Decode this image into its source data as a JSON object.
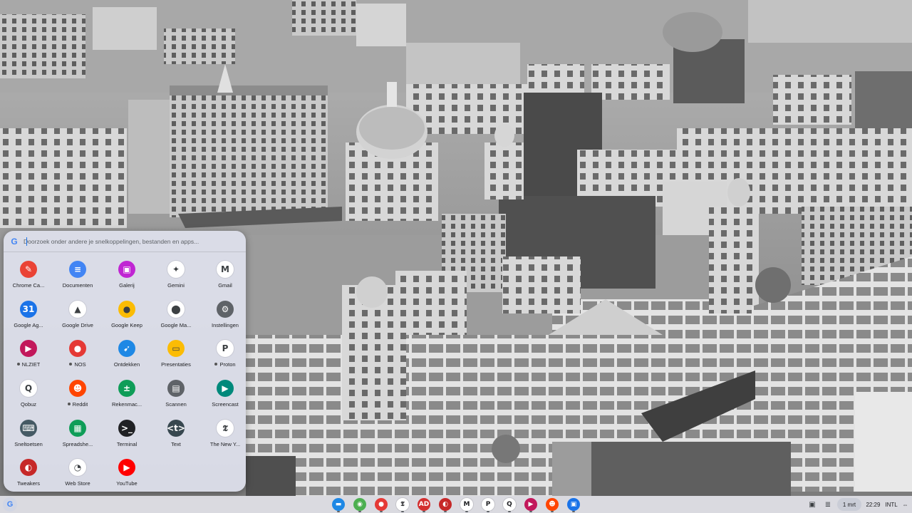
{
  "launcher": {
    "search_placeholder": "Doorzoek onder andere je snelkoppelingen, bestanden en apps...",
    "apps": [
      {
        "name": "Chrome Ca...",
        "icon": "chrome-canvas-icon",
        "color": "#ea4335",
        "glyph": "✎",
        "dot": false
      },
      {
        "name": "Documenten",
        "icon": "docs-icon",
        "color": "#4285f4",
        "glyph": "≡",
        "dot": false
      },
      {
        "name": "Galerij",
        "icon": "gallery-icon",
        "color": "#c026d3",
        "glyph": "▣",
        "dot": false
      },
      {
        "name": "Gemini",
        "icon": "gemini-icon",
        "color": "#ffffff",
        "glyph": "✦",
        "dot": false
      },
      {
        "name": "Gmail",
        "icon": "gmail-icon",
        "color": "#ffffff",
        "glyph": "M",
        "dot": false
      },
      {
        "name": "Google Ag...",
        "icon": "google-calendar-icon",
        "color": "#1a73e8",
        "glyph": "31",
        "dot": false
      },
      {
        "name": "Google Drive",
        "icon": "google-drive-icon",
        "color": "#ffffff",
        "glyph": "▲",
        "dot": false
      },
      {
        "name": "Google Keep",
        "icon": "google-keep-icon",
        "color": "#fbbc04",
        "glyph": "●",
        "dot": false
      },
      {
        "name": "Google Ma...",
        "icon": "google-maps-icon",
        "color": "#ffffff",
        "glyph": "⬤",
        "dot": false
      },
      {
        "name": "Instellingen",
        "icon": "settings-icon",
        "color": "#5f6368",
        "glyph": "⚙",
        "dot": false
      },
      {
        "name": "NLZIET",
        "icon": "nlziet-icon",
        "color": "#c2185b",
        "glyph": "▶",
        "dot": true
      },
      {
        "name": "NOS",
        "icon": "nos-icon",
        "color": "#e53935",
        "glyph": "●",
        "dot": true
      },
      {
        "name": "Ontdekken",
        "icon": "explore-icon",
        "color": "#1e88e5",
        "glyph": "➹",
        "dot": false
      },
      {
        "name": "Presentaties",
        "icon": "slides-icon",
        "color": "#fbbc04",
        "glyph": "▭",
        "dot": false
      },
      {
        "name": "Proton",
        "icon": "proton-icon",
        "color": "#ffffff",
        "glyph": "P",
        "dot": true
      },
      {
        "name": "Qobuz",
        "icon": "qobuz-icon",
        "color": "#ffffff",
        "glyph": "Q",
        "dot": false
      },
      {
        "name": "Reddit",
        "icon": "reddit-icon",
        "color": "#ff4500",
        "glyph": "☻",
        "dot": true
      },
      {
        "name": "Rekenmac...",
        "icon": "calculator-icon",
        "color": "#0f9d58",
        "glyph": "±",
        "dot": false
      },
      {
        "name": "Scannen",
        "icon": "scan-icon",
        "color": "#5f6368",
        "glyph": "▤",
        "dot": false
      },
      {
        "name": "Screencast",
        "icon": "screencast-icon",
        "color": "#00897b",
        "glyph": "▶",
        "dot": false
      },
      {
        "name": "Sneltoetsen",
        "icon": "shortcuts-icon",
        "color": "#455a64",
        "glyph": "⌨",
        "dot": false
      },
      {
        "name": "Spreadshe...",
        "icon": "sheets-icon",
        "color": "#0f9d58",
        "glyph": "▦",
        "dot": false
      },
      {
        "name": "Terminal",
        "icon": "terminal-icon",
        "color": "#202124",
        "glyph": ">_",
        "dot": false
      },
      {
        "name": "Text",
        "icon": "text-editor-icon",
        "color": "#37474f",
        "glyph": "<t>",
        "dot": false
      },
      {
        "name": "The New Y...",
        "icon": "nytimes-icon",
        "color": "#ffffff",
        "glyph": "𝕿",
        "dot": false
      },
      {
        "name": "Tweakers",
        "icon": "tweakers-icon",
        "color": "#c62828",
        "glyph": "◐",
        "dot": false
      },
      {
        "name": "Web Store",
        "icon": "web-store-icon",
        "color": "#ffffff",
        "glyph": "◔",
        "dot": false
      },
      {
        "name": "YouTube",
        "icon": "youtube-icon",
        "color": "#ff0000",
        "glyph": "▶",
        "dot": false
      }
    ]
  },
  "shelf": {
    "launcher_glyph": "G",
    "pinned": [
      {
        "icon": "files-icon",
        "color": "#1e88e5",
        "glyph": "▬"
      },
      {
        "icon": "chrome-icon",
        "color": "#4caf50",
        "glyph": "◉"
      },
      {
        "icon": "nos-icon",
        "color": "#e53935",
        "glyph": "●"
      },
      {
        "icon": "nytimes-icon",
        "color": "#ffffff",
        "glyph": "𝕿"
      },
      {
        "icon": "ad-icon",
        "color": "#d32f2f",
        "glyph": "AD"
      },
      {
        "icon": "tweakers-icon",
        "color": "#c62828",
        "glyph": "◐"
      },
      {
        "icon": "gmail-icon",
        "color": "#ffffff",
        "glyph": "M"
      },
      {
        "icon": "proton-icon",
        "color": "#ffffff",
        "glyph": "P"
      },
      {
        "icon": "qobuz-icon",
        "color": "#ffffff",
        "glyph": "Q"
      },
      {
        "icon": "nlziet-icon",
        "color": "#c2185b",
        "glyph": "▶"
      },
      {
        "icon": "reddit-icon",
        "color": "#ff4500",
        "glyph": "☻"
      },
      {
        "icon": "google-meet-icon",
        "color": "#1a73e8",
        "glyph": "▣"
      }
    ],
    "tray": {
      "window-icon": "▣",
      "clipboard-icon": "≣",
      "date": "1 mrt",
      "time": "22:29",
      "keyboard_layout": "INTL",
      "network-icon": "⇔"
    }
  }
}
